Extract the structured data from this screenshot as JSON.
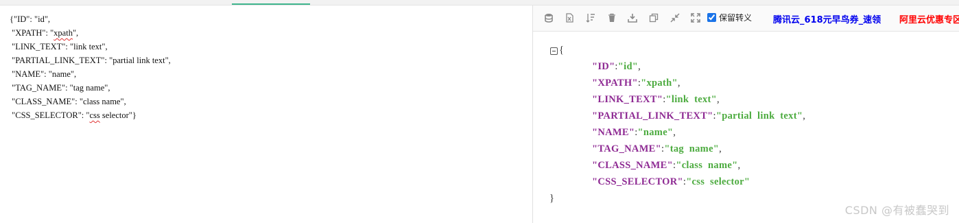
{
  "raw_input": {
    "lines": [
      "{\"ID\": \"id\",",
      " \"XPATH\": \"xpath\",",
      " \"LINK_TEXT\": \"link text\",",
      " \"PARTIAL_LINK_TEXT\": \"partial link text\",",
      " \"NAME\": \"name\",",
      " \"TAG_NAME\": \"tag name\",",
      " \"CLASS_NAME\": \"class name\",",
      " \"CSS_SELECTOR\": \"css selector\"}"
    ],
    "spellcheck_words": [
      "xpath",
      "css"
    ]
  },
  "toolbar": {
    "icons": [
      "database-icon",
      "excel-export-icon",
      "sort-icon",
      "trash-icon",
      "download-icon",
      "copy-icon",
      "compress-icon",
      "expand-icon"
    ],
    "keep_escape_label": "保留转义",
    "keep_escape_checked": true
  },
  "ads": {
    "tencent": "腾讯云_618元早鸟券_速领",
    "aliyun": "阿里云优惠专区"
  },
  "json_view": {
    "open_brace": "{",
    "close_brace": "}",
    "entries": [
      {
        "key": "\"ID\"",
        "value": "\"id\"",
        "sep": ","
      },
      {
        "key": "\"XPATH\"",
        "value": "\"xpath\"",
        "sep": ","
      },
      {
        "key": "\"LINK_TEXT\"",
        "value": "\"link  text\"",
        "sep": ","
      },
      {
        "key": "\"PARTIAL_LINK_TEXT\"",
        "value": "\"partial  link  text\"",
        "sep": ","
      },
      {
        "key": "\"NAME\"",
        "value": "\"name\"",
        "sep": ","
      },
      {
        "key": "\"TAG_NAME\"",
        "value": "\"tag  name\"",
        "sep": ","
      },
      {
        "key": "\"CLASS_NAME\"",
        "value": "\"class  name\"",
        "sep": ","
      },
      {
        "key": "\"CSS_SELECTOR\"",
        "value": "\"css  selector\"",
        "sep": ""
      }
    ]
  },
  "watermark": "CSDN @有被蠢哭到",
  "colors": {
    "key": "#8e2a93",
    "value": "#4cab3f",
    "tab_accent": "#3fb58d",
    "ad_blue": "#0000ee",
    "ad_red": "#ff0000"
  }
}
